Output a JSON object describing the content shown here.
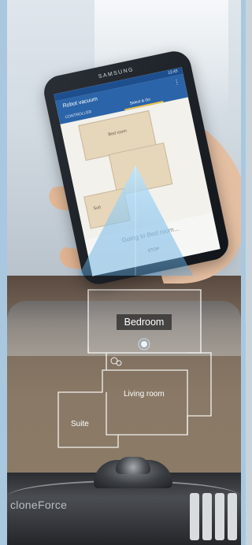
{
  "phone": {
    "brand": "SAMSUNG",
    "status_time": "12:45",
    "app_title": "Robot vacuum",
    "menu_icon": "more-vert-icon",
    "tabs": [
      {
        "label": "CONTROLLER",
        "active": false
      },
      {
        "label": "Select & Go",
        "active": true
      }
    ],
    "map_rooms": [
      "Bed room",
      "Suit"
    ],
    "status_message": "Going to Bed room...",
    "stop_label": "STOP"
  },
  "floor_plan": {
    "rooms": {
      "bedroom": "Bedroom",
      "living_room": "Living room",
      "suite": "Suite"
    },
    "target_marker_icon": "location-dot-icon",
    "robot_marker_icon": "robot-vacuum-icon"
  },
  "robot": {
    "brand": "cloneForce"
  },
  "colors": {
    "app_header": "#2b64a8",
    "tab_indicator": "#f0c44c",
    "frame": "#a9c8e0",
    "plan_lines": "#ffffff"
  }
}
